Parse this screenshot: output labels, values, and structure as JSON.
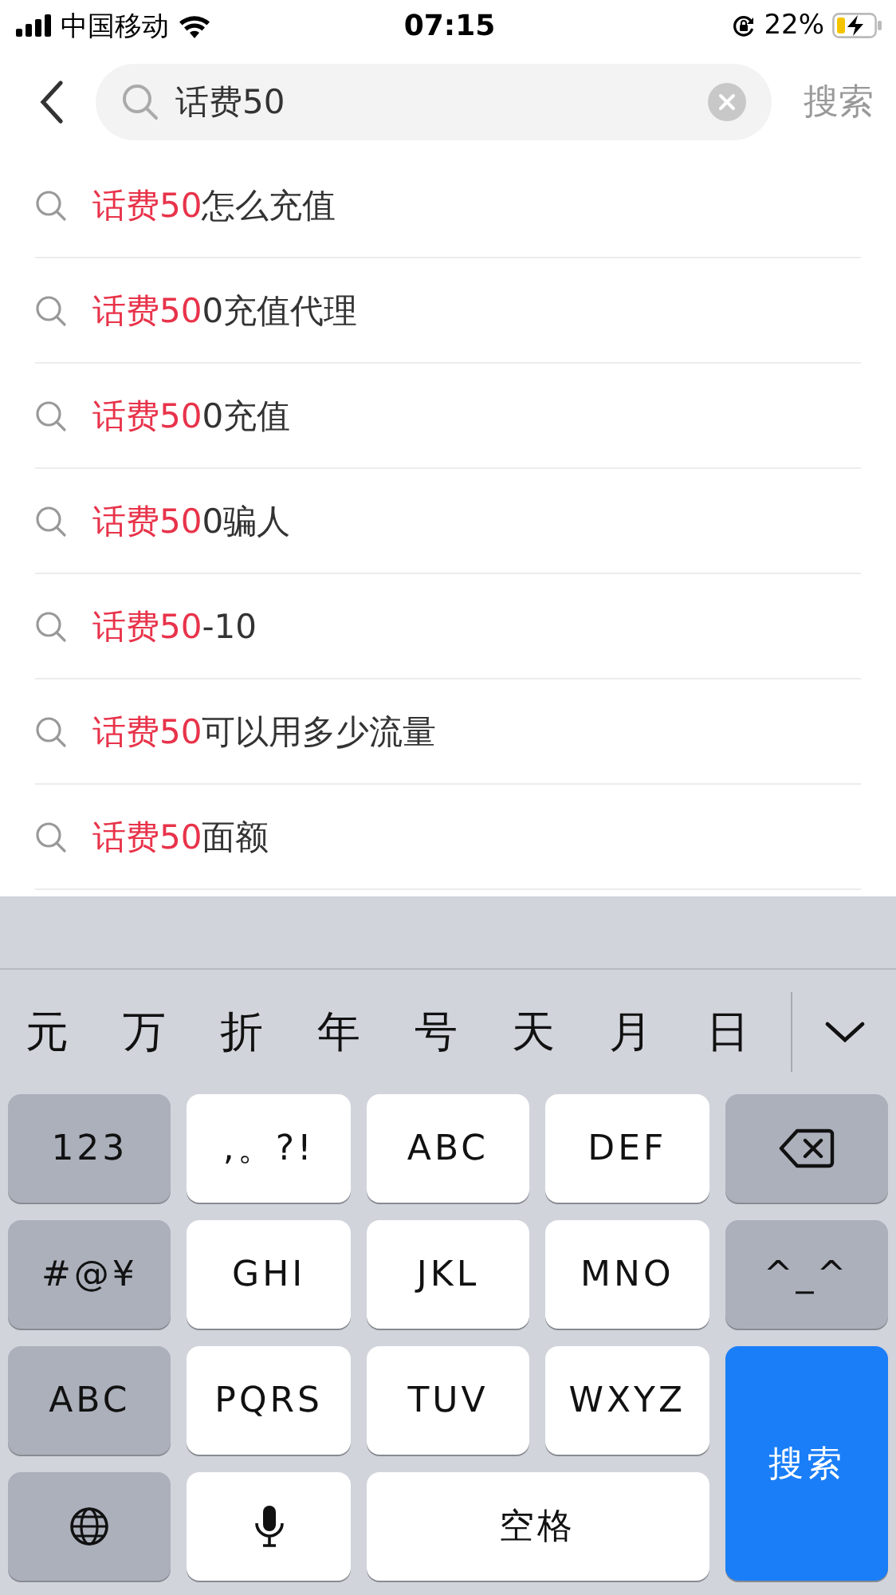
{
  "status_bar": {
    "carrier": "中国移动",
    "time": "07:15",
    "battery": "22%"
  },
  "search": {
    "value": "话费50",
    "button": "搜索"
  },
  "suggestions": [
    {
      "match": "话费50",
      "rest": "怎么充值"
    },
    {
      "match": "话费50",
      "rest": "0充值代理"
    },
    {
      "match": "话费50",
      "rest": "0充值"
    },
    {
      "match": "话费50",
      "rest": "0骗人"
    },
    {
      "match": "话费50",
      "rest": "-10"
    },
    {
      "match": "话费50",
      "rest": "可以用多少流量"
    },
    {
      "match": "话费50",
      "rest": "面额"
    }
  ],
  "candidates": [
    "元",
    "万",
    "折",
    "年",
    "号",
    "天",
    "月",
    "日"
  ],
  "keys": [
    {
      "kind": "function",
      "label": "123"
    },
    {
      "kind": "letter",
      "label": ",。?!"
    },
    {
      "kind": "letter",
      "label": "ABC"
    },
    {
      "kind": "letter",
      "label": "DEF"
    },
    {
      "kind": "backspace"
    },
    {
      "kind": "function",
      "label": "#@¥"
    },
    {
      "kind": "letter",
      "label": "GHI"
    },
    {
      "kind": "letter",
      "label": "JKL"
    },
    {
      "kind": "letter",
      "label": "MNO"
    },
    {
      "kind": "function",
      "label": "^_^"
    },
    {
      "kind": "function",
      "label": "ABC"
    },
    {
      "kind": "letter",
      "label": "PQRS"
    },
    {
      "kind": "letter",
      "label": "TUV"
    },
    {
      "kind": "letter",
      "label": "WXYZ"
    },
    {
      "kind": "action",
      "label": "搜索"
    },
    {
      "kind": "globe"
    },
    {
      "kind": "mic"
    },
    {
      "kind": "space",
      "label": "空格"
    }
  ]
}
